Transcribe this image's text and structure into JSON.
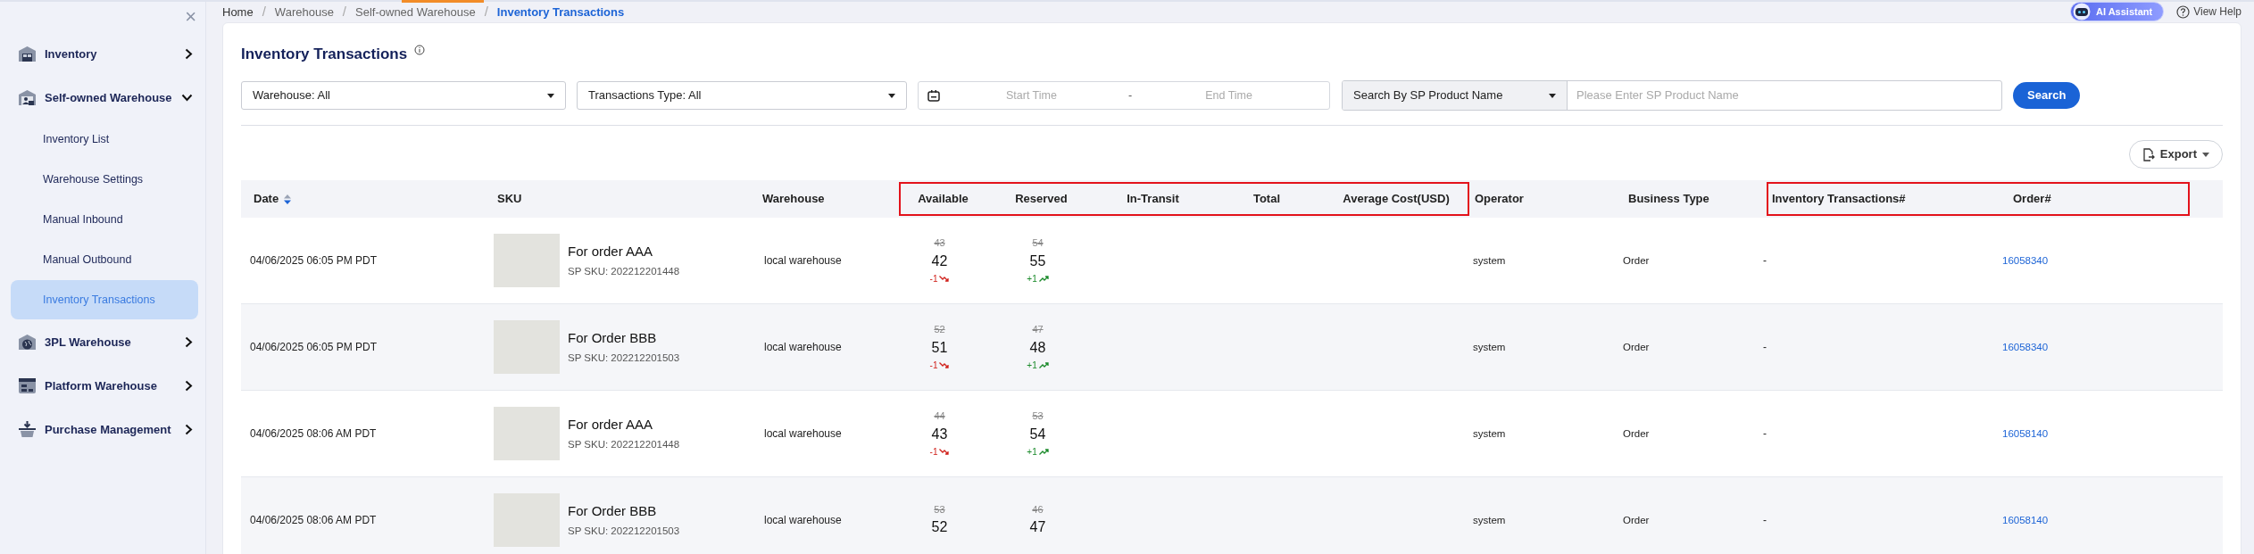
{
  "sidebar": {
    "close": "×",
    "items": [
      {
        "label": "Inventory",
        "expanded": false
      },
      {
        "label": "Self-owned Warehouse",
        "expanded": true,
        "children": [
          {
            "label": "Inventory List",
            "selected": false
          },
          {
            "label": "Warehouse Settings",
            "selected": false
          },
          {
            "label": "Manual Inbound",
            "selected": false
          },
          {
            "label": "Manual Outbound",
            "selected": false
          },
          {
            "label": "Inventory Transactions",
            "selected": true
          }
        ]
      },
      {
        "label": "3PL Warehouse",
        "expanded": false
      },
      {
        "label": "Platform Warehouse",
        "expanded": false
      },
      {
        "label": "Purchase Management",
        "expanded": false
      }
    ]
  },
  "breadcrumb": {
    "items": [
      "Home",
      "Warehouse",
      "Self-owned Warehouse",
      "Inventory Transactions"
    ],
    "separators": [
      "/",
      "/",
      "/"
    ]
  },
  "header_buttons": {
    "assistant": "AI Assistant",
    "help": "View Help"
  },
  "page_title": "Inventory Transactions",
  "filters": {
    "warehouse": "Warehouse: All",
    "transaction_type": "Transactions Type: All",
    "start_placeholder": "Start Time",
    "range_separator": "-",
    "end_placeholder": "End Time",
    "search_by": "Search By SP Product Name",
    "search_placeholder": "Please Enter SP Product Name",
    "search_button": "Search"
  },
  "export_button": "Export",
  "table": {
    "column_groups": [
      {
        "highlighted": false,
        "columns": [
          "Date",
          "SKU",
          "Warehouse"
        ]
      },
      {
        "highlighted": true,
        "columns": [
          "Available",
          "Reserved",
          "In-Transit",
          "Total",
          "Average Cost(USD)"
        ]
      },
      {
        "highlighted": false,
        "columns": [
          "Operator",
          "Business Type"
        ]
      },
      {
        "highlighted": true,
        "columns": [
          "Inventory Transactions#",
          "Order#"
        ]
      }
    ],
    "rows": [
      {
        "date": "04/06/2025 06:05 PM PDT",
        "product": "For order AAA",
        "sku": "SP SKU: 202212201448",
        "warehouse": "local warehouse",
        "available": {
          "old": "43",
          "new": "42",
          "change": "-1",
          "kind": "decrease"
        },
        "reserved": {
          "old": "54",
          "new": "55",
          "change": "+1",
          "kind": "increase"
        },
        "operator": "system",
        "business_type": "Order",
        "transaction_no": "-",
        "order_no": "16058340"
      },
      {
        "date": "04/06/2025 06:05 PM PDT",
        "product": "For Order BBB",
        "sku": "SP SKU: 202212201503",
        "warehouse": "local warehouse",
        "available": {
          "old": "52",
          "new": "51",
          "change": "-1",
          "kind": "decrease"
        },
        "reserved": {
          "old": "47",
          "new": "48",
          "change": "+1",
          "kind": "increase"
        },
        "operator": "system",
        "business_type": "Order",
        "transaction_no": "-",
        "order_no": "16058340"
      },
      {
        "date": "04/06/2025 08:06 AM PDT",
        "product": "For order AAA",
        "sku": "SP SKU: 202212201448",
        "warehouse": "local warehouse",
        "available": {
          "old": "44",
          "new": "43",
          "change": "-1",
          "kind": "decrease"
        },
        "reserved": {
          "old": "53",
          "new": "54",
          "change": "+1",
          "kind": "increase"
        },
        "operator": "system",
        "business_type": "Order",
        "transaction_no": "-",
        "order_no": "16058140"
      },
      {
        "date": "04/06/2025 08:06 AM PDT",
        "product": "For Order BBB",
        "sku": "SP SKU: 202212201503",
        "warehouse": "local warehouse",
        "available": {
          "old": "53",
          "new": "52"
        },
        "reserved": {
          "old": "46",
          "new": "47"
        },
        "operator": "system",
        "business_type": "Order",
        "transaction_no": "-",
        "order_no": "16058140"
      }
    ]
  }
}
